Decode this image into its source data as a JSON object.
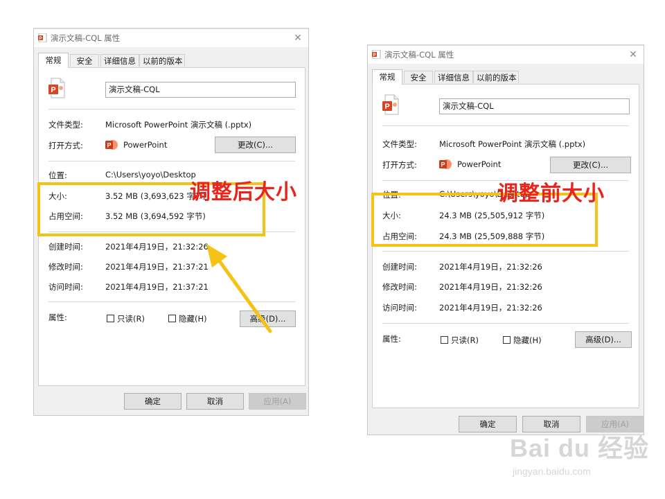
{
  "tabs": [
    "常规",
    "安全",
    "详细信息",
    "以前的版本"
  ],
  "labels": {
    "file_type": "文件类型:",
    "open_with": "打开方式:",
    "location": "位置:",
    "size": "大小:",
    "size_on_disk": "占用空间:",
    "created": "创建时间:",
    "modified": "修改时间:",
    "accessed": "访问时间:",
    "attributes": "属性:"
  },
  "buttons": {
    "change": "更改(C)...",
    "advanced": "高级(D)...",
    "ok": "确定",
    "cancel": "取消",
    "apply": "应用(A)"
  },
  "checkboxes": {
    "readonly": "只读(R)",
    "hidden": "隐藏(H)"
  },
  "colors": {
    "highlight": "#f5c216",
    "annotation": "#e8241c",
    "ppt": "#d24726"
  },
  "after": {
    "title": "演示文稿-CQL 属性",
    "file_name": "演示文稿-CQL",
    "file_type": "Microsoft PowerPoint 演示文稿 (.pptx)",
    "open_with": "PowerPoint",
    "location": "C:\\Users\\yoyo\\Desktop",
    "size": "3.52 MB (3,693,623 字节)",
    "size_on_disk": "3.52 MB (3,694,592 字节)",
    "created": "2021年4月19日，21:32:26",
    "modified": "2021年4月19日，21:37:21",
    "accessed": "2021年4月19日，21:37:21",
    "annotation": "调整后大小"
  },
  "before": {
    "title": "演示文稿-CQL 属性",
    "file_name": "演示文稿-CQL",
    "file_type": "Microsoft PowerPoint 演示文稿 (.pptx)",
    "open_with": "PowerPoint",
    "location": "C:\\Users\\yoyo\\Desktop",
    "size": "24.3 MB (25,505,912 字节)",
    "size_on_disk": "24.3 MB (25,509,888 字节)",
    "created": "2021年4月19日，21:32:26",
    "modified": "2021年4月19日，21:32:26",
    "accessed": "2021年4月19日，21:32:26",
    "annotation": "调整前大小"
  },
  "watermark": {
    "logo": "Bai du 经验",
    "sub": "jingyan.baidu.com"
  }
}
